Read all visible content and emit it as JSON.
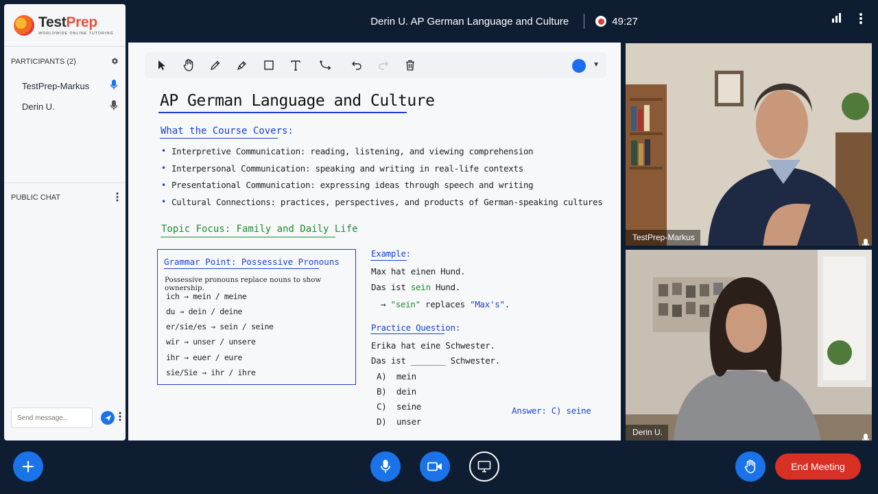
{
  "header": {
    "meeting_title": "Derin U. AP German Language and Culture",
    "timer": "49:27"
  },
  "brand": {
    "name_part1": "Test",
    "name_part2": "Prep",
    "tagline": "WORLDWIDE ONLINE TUTORING"
  },
  "sidebar": {
    "participants_label": "PARTICIPANTS (2)",
    "participants": [
      {
        "name": "TestPrep-Markus",
        "mic": "active"
      },
      {
        "name": "Derin U.",
        "mic": "idle"
      }
    ],
    "chat_label": "PUBLIC CHAT",
    "chat_placeholder": "Send message..."
  },
  "whiteboard": {
    "title": "AP German Language and Culture",
    "covers_heading": "What the Course Covers:",
    "bullets": [
      "Interpretive Communication: reading, listening, and viewing comprehension",
      "Interpersonal Communication: speaking and writing in real-life contexts",
      "Presentational Communication: expressing ideas through speech and writing",
      "Cultural Connections: practices, perspectives, and products of German-speaking cultures"
    ],
    "topic_heading": "Topic Focus: Family and Daily Life",
    "grammar": {
      "title": "Grammar Point: Possessive Pronouns",
      "description": "Possessive pronouns replace nouns to show ownership.",
      "rows": [
        {
          "subject": "ich",
          "possessive": "mein / meine"
        },
        {
          "subject": "du",
          "possessive": "dein / deine"
        },
        {
          "subject": "er/sie/es",
          "possessive": "sein / seine"
        },
        {
          "subject": "wir",
          "possessive": "unser / unsere"
        },
        {
          "subject": "ihr",
          "possessive": "euer / eure"
        },
        {
          "subject": "sie/Sie",
          "possessive": "ihr / ihre"
        }
      ]
    },
    "example": {
      "heading": "Example:",
      "line1": "Max hat einen Hund.",
      "line2_prefix": "Das ist ",
      "line2_highlight": "sein",
      "line2_suffix": " Hund.",
      "note_arrow": "→",
      "note_word": "\"sein\"",
      "note_mid": " replaces ",
      "note_target": "\"Max's\"",
      "note_end": "."
    },
    "practice": {
      "heading": "Practice Question:",
      "line1": "Erika hat eine Schwester.",
      "line2": "Das ist _______ Schwester.",
      "options": [
        {
          "letter": "A)",
          "text": "mein"
        },
        {
          "letter": "B)",
          "text": "dein"
        },
        {
          "letter": "C)",
          "text": "seine"
        },
        {
          "letter": "D)",
          "text": "unser"
        }
      ],
      "answer": "Answer: C) seine"
    },
    "pen_color": "#1a6cf0"
  },
  "videos": [
    {
      "name": "TestPrep-Markus"
    },
    {
      "name": "Derin U."
    }
  ],
  "controls": {
    "end_meeting_label": "End Meeting",
    "accent": "#1a73e8",
    "danger": "#d93025"
  }
}
